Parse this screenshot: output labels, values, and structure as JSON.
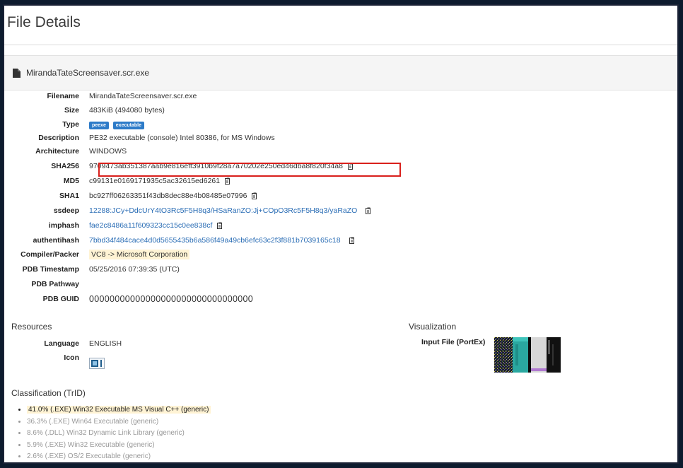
{
  "page": {
    "title": "File Details"
  },
  "panel": {
    "filename": "MirandaTateScreensaver.scr.exe"
  },
  "details": {
    "filename": {
      "label": "Filename",
      "value": "MirandaTateScreensaver.scr.exe"
    },
    "size": {
      "label": "Size",
      "value": "483KiB (494080 bytes)"
    },
    "type": {
      "label": "Type",
      "badges": [
        "peexe",
        "executable"
      ]
    },
    "description": {
      "label": "Description",
      "value": "PE32 executable (console) Intel 80386, for MS Windows"
    },
    "architecture": {
      "label": "Architecture",
      "value": "WINDOWS"
    },
    "sha256": {
      "label": "SHA256",
      "value": "9709473ab351387aab9e816eff3910b9f28a7a70202e250ed46dba8f820f34a8"
    },
    "md5": {
      "label": "MD5",
      "value": "c99131e0169171935c5ac32615ed6261"
    },
    "sha1": {
      "label": "SHA1",
      "value": "bc927ff06263351f43db8dec88e4b08485e07996"
    },
    "ssdeep": {
      "label": "ssdeep",
      "value": "12288:JCy+DdcUrY4tO3Rc5F5H8q3/HSaRanZO:Jj+COpO3Rc5F5H8q3/yaRaZO"
    },
    "imphash": {
      "label": "imphash",
      "value": "fae2c8486a11f609323cc15c0ee838cf"
    },
    "authentihash": {
      "label": "authentihash",
      "value": "7bbd34f484cace4d0d5655435b6a586f49a49cb6efc63c2f3f881b7039165c18"
    },
    "compiler": {
      "label": "Compiler/Packer",
      "value": "VC8 -> Microsoft Corporation"
    },
    "pdb_timestamp": {
      "label": "PDB Timestamp",
      "value": "05/25/2016 07:39:35 (UTC)"
    },
    "pdb_pathway": {
      "label": "PDB Pathway",
      "value": ""
    },
    "pdb_guid": {
      "label": "PDB GUID",
      "value": "00000000000000000000000000000000"
    }
  },
  "resources": {
    "title": "Resources",
    "language": {
      "label": "Language",
      "value": "ENGLISH"
    },
    "icon": {
      "label": "Icon"
    }
  },
  "visualization": {
    "title": "Visualization",
    "input_file": {
      "label": "Input File (PortEx)"
    }
  },
  "classification": {
    "title": "Classification (TrID)",
    "items": [
      "41.0% (.EXE) Win32 Executable MS Visual C++ (generic)",
      "36.3% (.EXE) Win64 Executable (generic)",
      "8.6% (.DLL) Win32 Dynamic Link Library (generic)",
      "5.9% (.EXE) Win32 Executable (generic)",
      "2.6% (.EXE) OS/2 Executable (generic)"
    ]
  }
}
